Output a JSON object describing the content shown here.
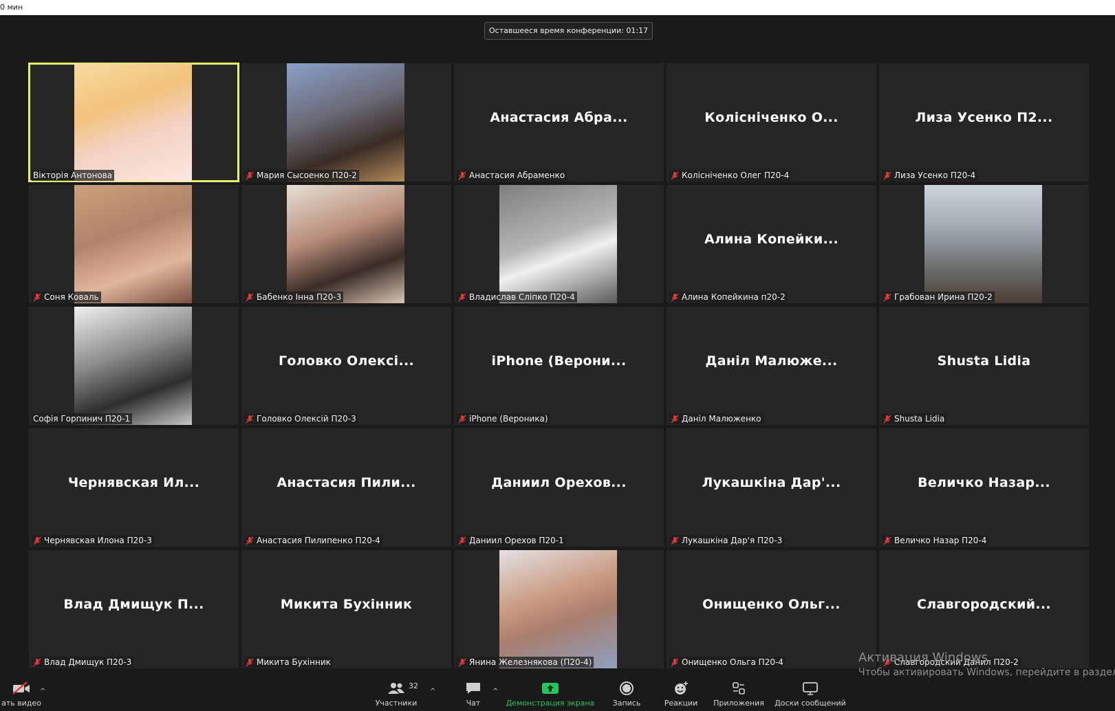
{
  "top_bar": {
    "text": "0 мин"
  },
  "timer": {
    "text": "Оставшееся время конференции: 01:17"
  },
  "colors": {
    "active_speaker": "#e7f26b",
    "mute": "#e03b3b",
    "share_green": "#22c55e"
  },
  "tiles": [
    {
      "label": "Вікторія Антонова",
      "big": "",
      "photo": "c-blonde",
      "muted": false,
      "active": true
    },
    {
      "label": "Мария Сысоенко П20-2",
      "big": "",
      "photo": "c-city",
      "muted": true,
      "active": false
    },
    {
      "label": "Анастасия Абраменко",
      "big": "Анастасия  Абра...",
      "photo": "",
      "muted": true,
      "active": false
    },
    {
      "label": "Колісніченко Олег П20-4",
      "big": "Колісніченко  О...",
      "photo": "",
      "muted": true,
      "active": false
    },
    {
      "label": "Лиза Усенко П20-4",
      "big": "Лиза  Усенко  П2...",
      "photo": "",
      "muted": true,
      "active": false
    },
    {
      "label": "Соня Коваль",
      "big": "",
      "photo": "c-soft",
      "muted": true,
      "active": false
    },
    {
      "label": "Бабенко Інна П20-3",
      "big": "",
      "photo": "c-noise",
      "muted": true,
      "active": false
    },
    {
      "label": "Владислав Сліпко П20-4",
      "big": "",
      "photo": "c-suit",
      "muted": true,
      "active": false
    },
    {
      "label": "Алина Копейкина п20-2",
      "big": "Алина  Копейки...",
      "photo": "",
      "muted": true,
      "active": false
    },
    {
      "label": "Грабован Ирина П20-2",
      "big": "",
      "photo": "c-sea",
      "muted": true,
      "active": false
    },
    {
      "label": "Софія Горпинич П20-1",
      "big": "",
      "photo": "c-bw",
      "muted": false,
      "active": false
    },
    {
      "label": "Головко Олексій П20-3",
      "big": "Головко  Олексі...",
      "photo": "",
      "muted": true,
      "active": false
    },
    {
      "label": "iPhone (Вероника)",
      "big": "iPhone  (Верони...",
      "photo": "",
      "muted": true,
      "active": false
    },
    {
      "label": "Даніл Малюженко",
      "big": "Даніл  Малюже...",
      "photo": "",
      "muted": true,
      "active": false
    },
    {
      "label": "Shusta Lidia",
      "big": "Shusta  Lidia",
      "photo": "",
      "muted": true,
      "active": false
    },
    {
      "label": "Чернявская Илона П20-3",
      "big": "Чернявская  Ил...",
      "photo": "",
      "muted": true,
      "active": false
    },
    {
      "label": "Анастасия Пилипенко П20-4",
      "big": "Анастасия  Пили...",
      "photo": "",
      "muted": true,
      "active": false
    },
    {
      "label": "Даниил Орехов П20-1",
      "big": "Даниил  Орехов...",
      "photo": "",
      "muted": true,
      "active": false
    },
    {
      "label": "Лукашкіна Дар'я П20-3",
      "big": "Лукашкіна  Дар'...",
      "photo": "",
      "muted": true,
      "active": false
    },
    {
      "label": "Величко Назар П20-4",
      "big": "Величко  Назар...",
      "photo": "",
      "muted": true,
      "active": false
    },
    {
      "label": "Влад Дмищук П20-3",
      "big": "Влад  Дмищук  П...",
      "photo": "",
      "muted": true,
      "active": false
    },
    {
      "label": "Микита Бухінник",
      "big": "Микита  Бухінник",
      "photo": "",
      "muted": true,
      "active": false
    },
    {
      "label": "Янина Железнякова (П20-4)",
      "big": "",
      "photo": "c-flower",
      "muted": true,
      "active": false
    },
    {
      "label": "Онищенко Ольга П20-4",
      "big": "Онищенко  Ольг...",
      "photo": "",
      "muted": true,
      "active": false
    },
    {
      "label": "Славгородский Данил П20-2",
      "big": "Славгородский...",
      "photo": "",
      "muted": true,
      "active": false
    }
  ],
  "watermark": {
    "line1": "Активация Windows",
    "line2": "Чтобы активировать Windows, перейдите в раздел \"П"
  },
  "toolbar": {
    "video": "ать видео",
    "participants": "Участники",
    "participants_count": "32",
    "chat": "Чат",
    "share": "Демонстрация экрана",
    "record": "Запись",
    "reactions": "Реакции",
    "apps": "Приложения",
    "boards": "Доски сообщений"
  }
}
